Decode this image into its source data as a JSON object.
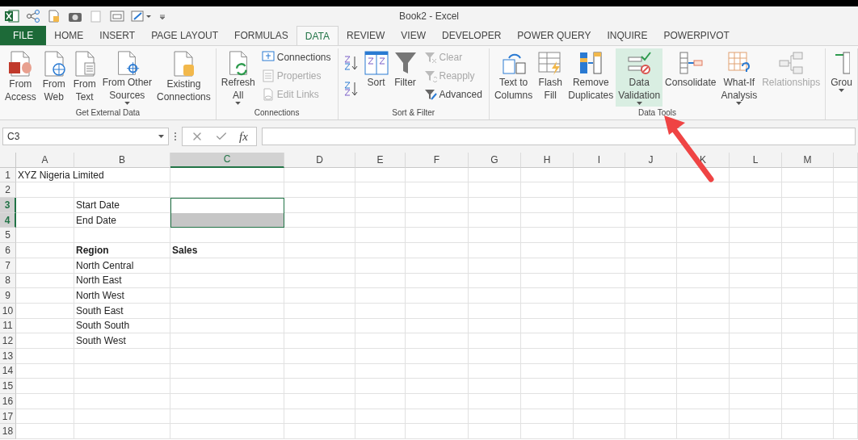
{
  "window": {
    "title": "Book2 - Excel"
  },
  "tabs": [
    {
      "label": "FILE",
      "kind": "file",
      "selected": false
    },
    {
      "label": "HOME",
      "kind": "tab",
      "selected": false
    },
    {
      "label": "INSERT",
      "kind": "tab",
      "selected": false
    },
    {
      "label": "PAGE LAYOUT",
      "kind": "tab",
      "selected": false
    },
    {
      "label": "FORMULAS",
      "kind": "tab",
      "selected": false
    },
    {
      "label": "DATA",
      "kind": "tab",
      "selected": true
    },
    {
      "label": "REVIEW",
      "kind": "tab",
      "selected": false
    },
    {
      "label": "VIEW",
      "kind": "tab",
      "selected": false
    },
    {
      "label": "DEVELOPER",
      "kind": "tab",
      "selected": false
    },
    {
      "label": "POWER QUERY",
      "kind": "tab",
      "selected": false
    },
    {
      "label": "INQUIRE",
      "kind": "tab",
      "selected": false
    },
    {
      "label": "POWERPIVOT",
      "kind": "tab",
      "selected": false
    }
  ],
  "ribbon": {
    "groups": [
      {
        "label": "Get External Data",
        "items": [
          {
            "kind": "large",
            "lines": [
              "From",
              "Access"
            ],
            "dropdown": false,
            "disabled": false,
            "selected": false
          },
          {
            "kind": "large",
            "lines": [
              "From",
              "Web"
            ],
            "dropdown": false,
            "disabled": false,
            "selected": false
          },
          {
            "kind": "large",
            "lines": [
              "From",
              "Text"
            ],
            "dropdown": false,
            "disabled": false,
            "selected": false
          },
          {
            "kind": "large",
            "lines": [
              "From Other",
              "Sources"
            ],
            "dropdown": true,
            "disabled": false,
            "selected": false
          },
          {
            "kind": "large",
            "lines": [
              "Existing",
              "Connections"
            ],
            "dropdown": false,
            "disabled": false,
            "selected": false
          }
        ]
      },
      {
        "label": "Connections",
        "items": [
          {
            "kind": "large",
            "lines": [
              "Refresh",
              "All"
            ],
            "dropdown": true,
            "disabled": false,
            "selected": false
          },
          {
            "kind": "stack",
            "items": [
              {
                "label": "Connections",
                "disabled": false
              },
              {
                "label": "Properties",
                "disabled": true
              },
              {
                "label": "Edit Links",
                "disabled": true
              }
            ]
          }
        ]
      },
      {
        "label": "Sort & Filter",
        "items": [
          {
            "kind": "sort-buttons"
          },
          {
            "kind": "large",
            "lines": [
              "Sort"
            ],
            "dropdown": false,
            "disabled": false,
            "selected": false
          },
          {
            "kind": "large",
            "lines": [
              "Filter"
            ],
            "dropdown": false,
            "disabled": false,
            "selected": false
          },
          {
            "kind": "stack",
            "items": [
              {
                "label": "Clear",
                "disabled": true
              },
              {
                "label": "Reapply",
                "disabled": true
              },
              {
                "label": "Advanced",
                "disabled": false
              }
            ]
          }
        ]
      },
      {
        "label": "Data Tools",
        "items": [
          {
            "kind": "large",
            "lines": [
              "Text to",
              "Columns"
            ],
            "dropdown": false,
            "disabled": false,
            "selected": false
          },
          {
            "kind": "large",
            "lines": [
              "Flash",
              "Fill"
            ],
            "dropdown": false,
            "disabled": false,
            "selected": false
          },
          {
            "kind": "large",
            "lines": [
              "Remove",
              "Duplicates"
            ],
            "dropdown": false,
            "disabled": false,
            "selected": false
          },
          {
            "kind": "large",
            "lines": [
              "Data",
              "Validation"
            ],
            "dropdown": true,
            "disabled": false,
            "selected": true
          },
          {
            "kind": "large",
            "lines": [
              "Consolidate"
            ],
            "dropdown": false,
            "disabled": false,
            "selected": false
          },
          {
            "kind": "large",
            "lines": [
              "What-If",
              "Analysis"
            ],
            "dropdown": true,
            "disabled": false,
            "selected": false
          },
          {
            "kind": "large",
            "lines": [
              "Relationships"
            ],
            "dropdown": false,
            "disabled": true,
            "selected": false
          }
        ]
      },
      {
        "items": [
          {
            "kind": "large",
            "lines": [
              "Grou"
            ],
            "dropdown": true,
            "disabled": false,
            "selected": false
          }
        ]
      }
    ]
  },
  "formula_bar": {
    "name_box": "C3",
    "function_button": "fx"
  },
  "sheet": {
    "columns": [
      {
        "label": "A",
        "selected": false
      },
      {
        "label": "B",
        "selected": false
      },
      {
        "label": "C",
        "selected": true
      },
      {
        "label": "D",
        "selected": false
      },
      {
        "label": "E",
        "selected": false
      },
      {
        "label": "F",
        "selected": false
      },
      {
        "label": "G",
        "selected": false
      },
      {
        "label": "H",
        "selected": false
      },
      {
        "label": "I",
        "selected": false
      },
      {
        "label": "J",
        "selected": false
      },
      {
        "label": "K",
        "selected": false
      },
      {
        "label": "L",
        "selected": false
      },
      {
        "label": "M",
        "selected": false
      }
    ],
    "rows": [
      {
        "number": "1",
        "selected": false,
        "column_a": "XYZ Nigeria Limited"
      },
      {
        "number": "2",
        "selected": false
      },
      {
        "number": "3",
        "selected": true,
        "active": true,
        "column_b": "Start Date"
      },
      {
        "number": "4",
        "selected": true,
        "active": false,
        "column_b": "End Date"
      },
      {
        "number": "5",
        "selected": false
      },
      {
        "number": "6",
        "selected": false,
        "bold": true,
        "column_b": "Region",
        "column_c": "Sales"
      },
      {
        "number": "7",
        "selected": false,
        "column_b": "North Central"
      },
      {
        "number": "8",
        "selected": false,
        "column_b": "North East"
      },
      {
        "number": "9",
        "selected": false,
        "column_b": "North West"
      },
      {
        "number": "10",
        "selected": false,
        "column_b": "South East"
      },
      {
        "number": "11",
        "selected": false,
        "column_b": "South South"
      },
      {
        "number": "12",
        "selected": false,
        "column_b": "South West"
      },
      {
        "number": "13",
        "selected": false
      },
      {
        "number": "14",
        "selected": false
      },
      {
        "number": "15",
        "selected": false
      },
      {
        "number": "16",
        "selected": false
      },
      {
        "number": "17",
        "selected": false
      },
      {
        "number": "18",
        "selected": false
      }
    ]
  }
}
